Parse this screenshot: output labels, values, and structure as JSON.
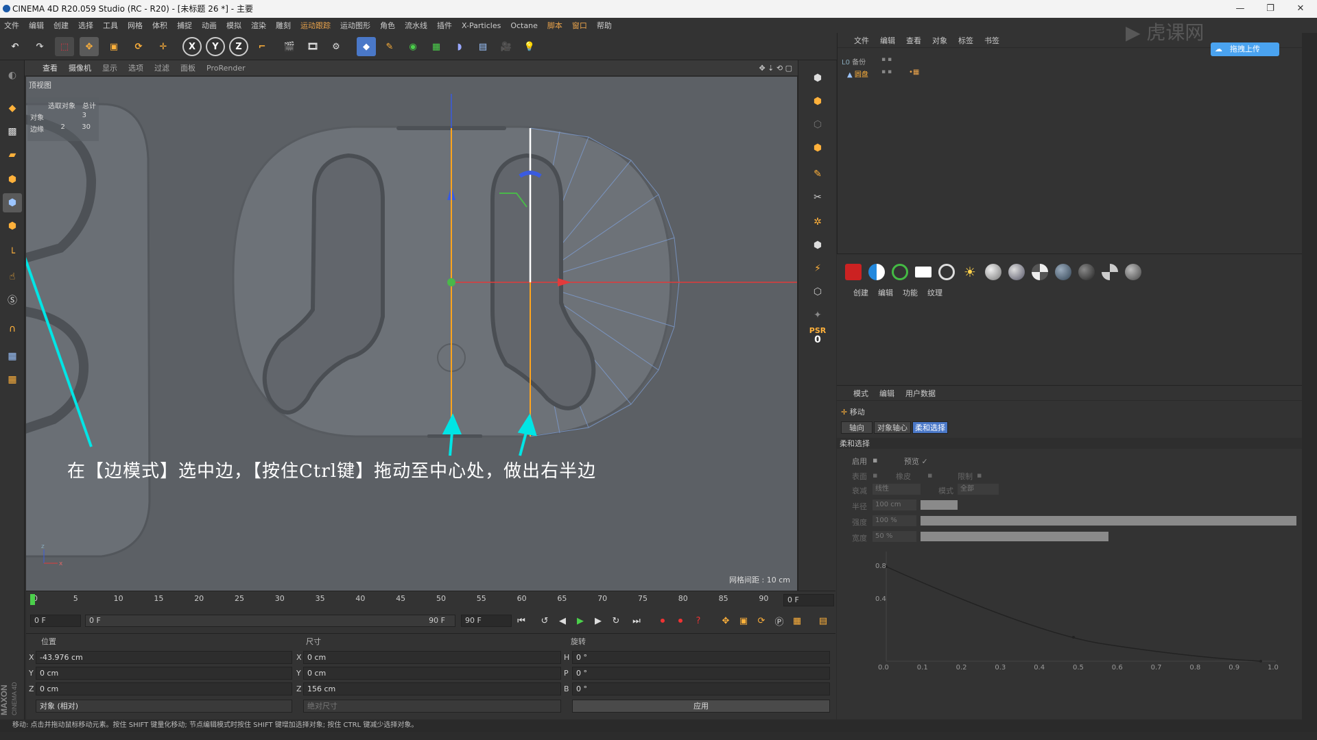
{
  "window": {
    "title": "CINEMA 4D R20.059 Studio (RC - R20) - [未标题 26 *] - 主要"
  },
  "menubar": [
    "文件",
    "编辑",
    "创建",
    "选择",
    "工具",
    "网格",
    "体积",
    "捕捉",
    "动画",
    "模拟",
    "渲染",
    "雕刻",
    "运动跟踪",
    "运动图形",
    "角色",
    "流水线",
    "插件",
    "X-Particles",
    "Octane",
    "脚本",
    "窗口",
    "帮助"
  ],
  "toolbar": {
    "axis_x": "X",
    "axis_y": "Y",
    "axis_z": "Z"
  },
  "viewport": {
    "menu": [
      "查看",
      "摄像机",
      "显示",
      "选项",
      "过滤",
      "面板",
      "ProRender"
    ],
    "name": "顶视图",
    "hud": {
      "header_a": "选取对象",
      "header_b": "总计",
      "rows": [
        {
          "label": "对象",
          "a": "",
          "b": "3"
        },
        {
          "label": "边缘",
          "a": "2",
          "b": "30"
        }
      ]
    },
    "grid_label": "网格间距 : 10 cm",
    "caption": "在【边模式】选中边，【按住Ctrl键】拖动至中心处，做出右半边",
    "psr_label": "PSR",
    "psr_value": "0"
  },
  "timeline": {
    "ticks": [
      "0",
      "5",
      "10",
      "15",
      "20",
      "25",
      "30",
      "35",
      "40",
      "45",
      "50",
      "55",
      "60",
      "65",
      "70",
      "75",
      "80",
      "85",
      "90"
    ],
    "end_field": "0 F"
  },
  "transport": {
    "current": "0 F",
    "range_start": "0 F",
    "range_end": "90 F",
    "max": "90 F"
  },
  "coords": {
    "headers": {
      "position": "位置",
      "size": "尺寸",
      "rotation": "旋转"
    },
    "position": {
      "x": "-43.976 cm",
      "y": "0 cm",
      "z": "0 cm"
    },
    "size": {
      "x": "0 cm",
      "y": "0 cm",
      "z": "156 cm"
    },
    "rotation": {
      "h": "0 °",
      "p": "0 °",
      "b": "0 °"
    },
    "axis_labels": {
      "x": "X",
      "y": "Y",
      "z": "Z",
      "h": "H",
      "p": "P",
      "b": "B"
    },
    "mode_select": "对象 (相对)",
    "size_select": "绝对尺寸",
    "apply_button": "应用"
  },
  "object_manager": {
    "menu": [
      "文件",
      "编辑",
      "查看",
      "对象",
      "标签",
      "书签"
    ],
    "objects": [
      {
        "name": "备份"
      },
      {
        "name": "圆盘"
      }
    ],
    "upload_badge": "拖拽上传"
  },
  "material_manager": {
    "menu": [
      "创建",
      "编辑",
      "功能",
      "纹理"
    ]
  },
  "attributes": {
    "menu": [
      "模式",
      "编辑",
      "用户数据"
    ],
    "tool_title": "移动",
    "tabs": [
      "轴向",
      "对象轴心",
      "柔和选择"
    ],
    "section": "柔和选择",
    "enable": "启用",
    "preview": "预览 ✓",
    "surface": "表面",
    "rubber": "橡皮",
    "limit": "限制",
    "falloff_label": "衰减",
    "falloff_value": "线性",
    "mode_label": "模式",
    "mode_value": "全部",
    "radius_label": "半径",
    "radius_value": "100 cm",
    "strength_label": "强度",
    "strength_value": "100 %",
    "width_label": "宽度",
    "width_value": "50 %",
    "graph_y": [
      "0.8",
      "0.4"
    ],
    "graph_x": [
      "0.0",
      "0.1",
      "0.2",
      "0.3",
      "0.4",
      "0.5",
      "0.6",
      "0.7",
      "0.8",
      "0.9",
      "1.0"
    ]
  },
  "status": "移动: 点击并拖动鼠标移动元素。按住 SHIFT 键量化移动; 节点编辑模式时按住 SHIFT 键增加选择对象; 按住 CTRL 键减少选择对象。",
  "colors": {
    "accent": "#e8a24b",
    "x_axis": "#e23b3b",
    "y_axis": "#4ab84a",
    "z_axis": "#3a5be0",
    "annotation": "#00e5e5"
  }
}
